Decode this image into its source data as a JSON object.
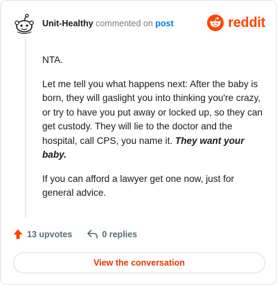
{
  "header": {
    "username": "Unit-Healthy",
    "action_text": "commented on",
    "link_text": "post"
  },
  "brand": {
    "name": "reddit",
    "icon": "reddit-snoo-icon",
    "color": "#ff4500"
  },
  "comment": {
    "paragraph_1": "NTA.",
    "paragraph_2_text": "Let me tell you what happens next: After the baby is born, they will gaslight you into thinking you're crazy, or try to have you put away or locked up, so they can get custody. They will lie to the doctor and the hospital, call CPS, you name it. ",
    "paragraph_2_emphasis": "They want your baby.",
    "paragraph_3": "If you can afford a lawyer get one now, just for general advice."
  },
  "actions": {
    "upvotes_label": "13 upvotes",
    "upvote_icon": "upvote-arrow-icon",
    "replies_label": "0 replies",
    "reply_icon": "reply-arrow-icon"
  },
  "cta": {
    "label": "View the conversation"
  },
  "colors": {
    "accent": "#ff4500",
    "link": "#0079d3",
    "cta_text": "#d93a00"
  }
}
